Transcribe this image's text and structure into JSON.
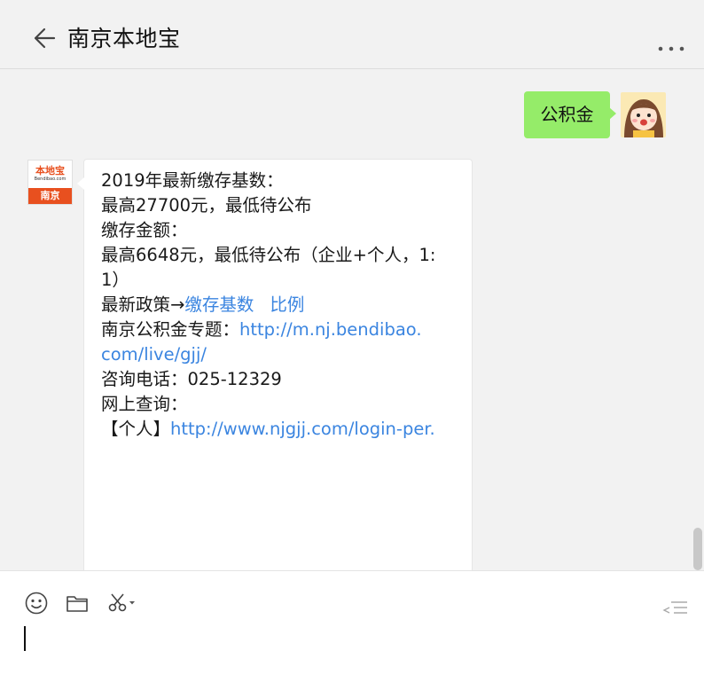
{
  "window": {
    "controls": [
      "pin-icon",
      "minimize-icon",
      "maximize-icon",
      "close-icon"
    ]
  },
  "header": {
    "title": "南京本地宝",
    "back_icon": "arrow-left-icon",
    "more_icon": "more-dots-icon"
  },
  "messages": {
    "user": {
      "text": "公积金"
    },
    "bot": {
      "avatar": {
        "brand_top": "本地宝",
        "brand_url": "Bendibao.com",
        "brand_bottom": "南京"
      },
      "lines": {
        "l1": "2019年最新缴存基数：",
        "l2": "最高27700元，最低待公布",
        "l3": "缴存金额：",
        "l4": "最高6648元，最低待公布（企业+个人，1:",
        "l5": "1）",
        "l6_prefix": "最新政策→",
        "l6_link1": "缴存基数",
        "l6_link2": "比例",
        "l7_prefix": "南京公积金专题：",
        "l7_link": "http://m.nj.bendibao.",
        "l8_link": "com/live/gjj/",
        "l9": "咨询电话：025-12329",
        "l10": "网上查询：",
        "l11_prefix": "【个人】",
        "l11_link": "http://www.njgjj.com/login-per."
      }
    }
  },
  "toolbar": {
    "icons": [
      "emoji-icon",
      "folder-icon",
      "scissors-icon",
      "send-icon"
    ]
  },
  "colors": {
    "user_bubble": "#95ec69",
    "link": "#3b85e0",
    "brand": "#e8501f",
    "background": "#f2f2f2"
  }
}
